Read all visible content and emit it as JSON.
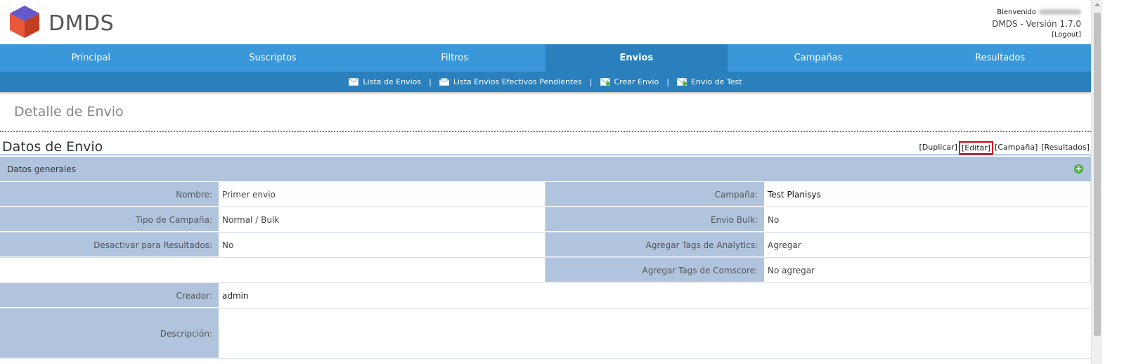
{
  "brand": {
    "name": "DMDS"
  },
  "user": {
    "welcome": "Bienvenido",
    "version": "DMDS - Versión 1.7.0",
    "logout": "[Logout]"
  },
  "mainnav": {
    "tabs": [
      {
        "label": "Principal"
      },
      {
        "label": "Suscriptos"
      },
      {
        "label": "Filtros"
      },
      {
        "label": "Envios",
        "active": true
      },
      {
        "label": "Campañas"
      },
      {
        "label": "Resultados"
      }
    ]
  },
  "subnav": {
    "items": [
      {
        "label": "Lista de Envios"
      },
      {
        "label": "Lista Envios Efectivos Pendientes"
      },
      {
        "label": "Crear Envio"
      },
      {
        "label": "Envio de Test"
      }
    ],
    "separator": "|"
  },
  "page": {
    "title": "Detalle de Envio"
  },
  "section": {
    "title": "Datos de Envio",
    "actions": {
      "duplicar": "[Duplicar]",
      "editar": "[Editar]",
      "campana": "[Campaña]",
      "resultados": "[Resultados]"
    }
  },
  "grid": {
    "header": "Datos generales",
    "add": "+",
    "rows": {
      "nombre": {
        "label": "Nombre:",
        "value": "Primer envio"
      },
      "campana": {
        "label": "Campaña:",
        "value": "Test Planisys"
      },
      "tipo": {
        "label": "Tipo de Campaña:",
        "value": "Normal / Bulk"
      },
      "bulk": {
        "label": "Envio Bulk:",
        "value": "No"
      },
      "desactivar": {
        "label": "Desactivar para Resultados:",
        "value": "No"
      },
      "analytics": {
        "label": "Agregar Tags de Analytics:",
        "value": "Agregar"
      },
      "comscore": {
        "label": "Agregar Tags de Comscore:",
        "value": "No agregar"
      },
      "creador": {
        "label": "Creador:",
        "value": "admin"
      },
      "descripcion": {
        "label": "Descripción:",
        "value": ""
      }
    }
  },
  "colors": {
    "nav": "#3a97d9",
    "nav_active": "#2a7fbd",
    "label_bg": "#b0c4de",
    "highlight": "#e00000"
  }
}
